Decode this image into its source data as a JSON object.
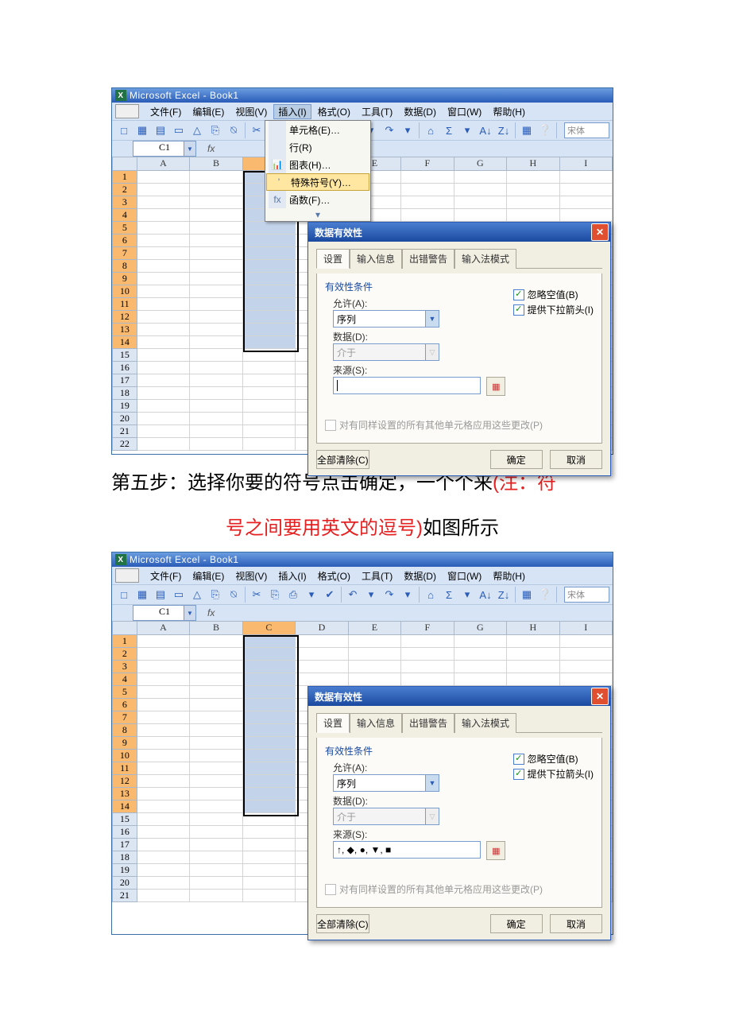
{
  "app": {
    "title": "Microsoft Excel - Book1"
  },
  "menu": {
    "items": [
      "文件(F)",
      "编辑(E)",
      "视图(V)",
      "插入(I)",
      "格式(O)",
      "工具(T)",
      "数据(D)",
      "窗口(W)",
      "帮助(H)"
    ],
    "active_index": 3
  },
  "insert_menu": {
    "items": [
      {
        "label": "单元格(E)…",
        "icon": ""
      },
      {
        "label": "行(R)",
        "icon": ""
      },
      {
        "label": "图表(H)…",
        "icon": "📊"
      },
      {
        "label": "特殊符号(Y)…",
        "icon": "'",
        "hover": true
      },
      {
        "label": "函数(F)…",
        "icon": "fx"
      }
    ]
  },
  "toolbar": {
    "font": "宋体"
  },
  "namebox": {
    "value": "C1",
    "fx": "fx"
  },
  "columns": [
    "A",
    "B",
    "C",
    "D",
    "E",
    "F",
    "G",
    "H",
    "I"
  ],
  "rows1": 22,
  "rows2": 21,
  "sel_col_index": 2,
  "sel_row_count": 14,
  "dialog": {
    "title": "数据有效性",
    "tabs": [
      "设置",
      "输入信息",
      "出错警告",
      "输入法模式"
    ],
    "active_tab": 0,
    "group": "有效性条件",
    "allow_label": "允许(A):",
    "allow_value": "序列",
    "data_label": "数据(D):",
    "data_value": "介于",
    "source_label": "来源(S):",
    "source_value_1": "",
    "source_value_2": "↑, ◆, ●, ▼, ■",
    "chk_ignoreblank": "忽略空值(B)",
    "chk_incell": "提供下拉箭头(I)",
    "apply_label": "对有同样设置的所有其他单元格应用这些更改(P)",
    "clear_btn": "全部清除(C)",
    "ok_btn": "确定",
    "cancel_btn": "取消"
  },
  "instruction": {
    "line1_black": "第五步：选择你要的符号点击确定，一个个来",
    "line1_red_open": "(注：符",
    "line2_red": "号之间要用英文的逗号)",
    "line2_black": "如图所示"
  }
}
